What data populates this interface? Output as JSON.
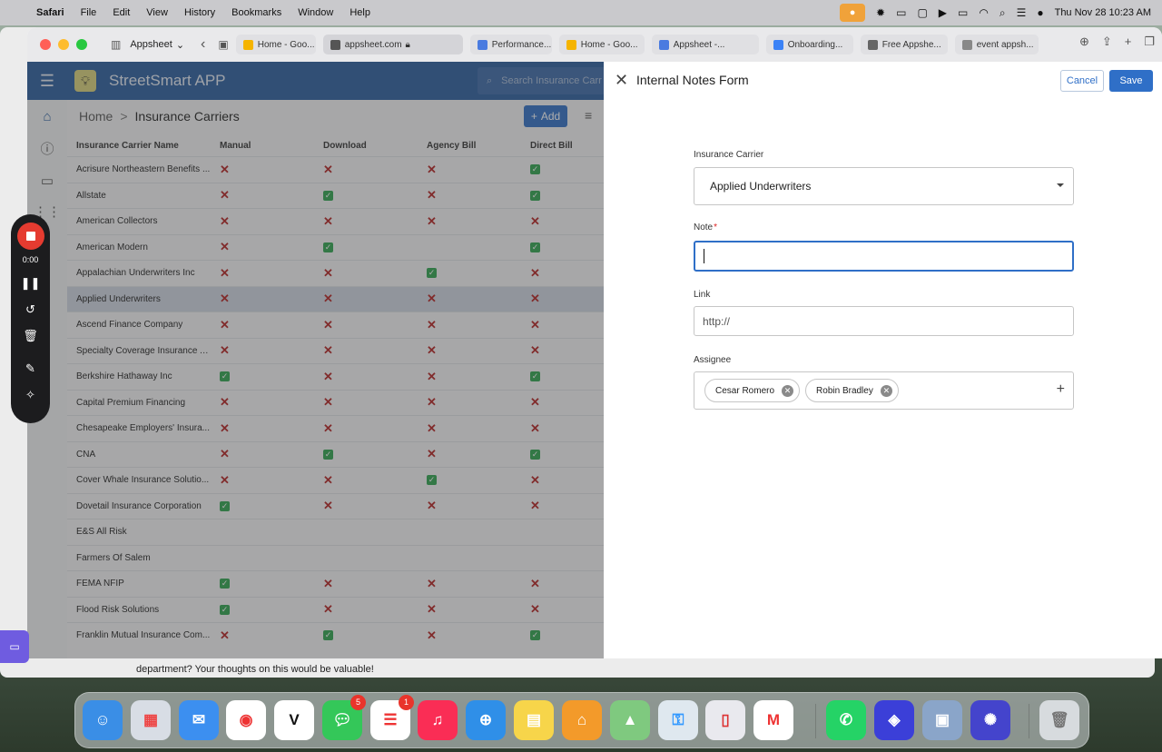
{
  "menubar": {
    "items": [
      "Safari",
      "File",
      "Edit",
      "View",
      "History",
      "Bookmarks",
      "Window",
      "Help"
    ],
    "clock": "Thu Nov 28  10:23 AM"
  },
  "browser": {
    "workspace": "Appsheet",
    "tabs": [
      {
        "label": "Home - Goo...",
        "color": "#f5b400"
      },
      {
        "label": "appsheet.com",
        "color": "#555555",
        "active": true
      },
      {
        "label": "Performance...",
        "color": "#4a7be0"
      },
      {
        "label": "Home - Goo...",
        "color": "#f5b400"
      },
      {
        "label": "Appsheet -...",
        "color": "#4a7be0"
      },
      {
        "label": "Onboarding...",
        "color": "#3b82f6"
      },
      {
        "label": "Free Appshe...",
        "color": "#666666"
      },
      {
        "label": "event appsh...",
        "color": "#888888"
      }
    ]
  },
  "app": {
    "title": "StreetSmart APP",
    "search_placeholder": "Search Insurance Carr",
    "breadcrumb_home": "Home",
    "breadcrumb_sep": ">",
    "breadcrumb_current": "Insurance Carriers",
    "add_label": "Add",
    "columns": [
      "Insurance Carrier Name",
      "Manual",
      "Download",
      "Agency Bill",
      "Direct Bill"
    ],
    "rows": [
      {
        "name": "Acrisure Northeastern Benefits ...",
        "v": [
          "x",
          "x",
          "x",
          "c"
        ]
      },
      {
        "name": "Allstate",
        "v": [
          "x",
          "c",
          "x",
          "c"
        ]
      },
      {
        "name": "American Collectors",
        "v": [
          "x",
          "x",
          "x",
          "x"
        ]
      },
      {
        "name": "American Modern",
        "v": [
          "x",
          "c",
          "",
          "c"
        ]
      },
      {
        "name": "Appalachian Underwriters Inc",
        "v": [
          "x",
          "x",
          "c",
          "x"
        ]
      },
      {
        "name": "Applied Underwriters",
        "v": [
          "x",
          "x",
          "x",
          "x"
        ],
        "selected": true
      },
      {
        "name": "Ascend Finance Company",
        "v": [
          "x",
          "x",
          "x",
          "x"
        ]
      },
      {
        "name": "Specialty Coverage Insurance A...",
        "v": [
          "x",
          "x",
          "x",
          "x"
        ]
      },
      {
        "name": "Berkshire Hathaway Inc",
        "v": [
          "c",
          "x",
          "x",
          "c"
        ]
      },
      {
        "name": "Capital Premium Financing",
        "v": [
          "x",
          "x",
          "x",
          "x"
        ]
      },
      {
        "name": "Chesapeake Employers' Insura...",
        "v": [
          "x",
          "x",
          "x",
          "x"
        ]
      },
      {
        "name": "CNA",
        "v": [
          "x",
          "c",
          "x",
          "c"
        ]
      },
      {
        "name": "Cover Whale Insurance Solutio...",
        "v": [
          "x",
          "x",
          "c",
          "x"
        ]
      },
      {
        "name": "Dovetail Insurance Corporation",
        "v": [
          "c",
          "x",
          "x",
          "x"
        ]
      },
      {
        "name": "E&S All Risk",
        "v": [
          "",
          "",
          "",
          ""
        ]
      },
      {
        "name": "Farmers Of Salem",
        "v": [
          "",
          "",
          "",
          ""
        ]
      },
      {
        "name": "FEMA NFIP",
        "v": [
          "c",
          "x",
          "x",
          "x"
        ]
      },
      {
        "name": "Flood Risk Solutions",
        "v": [
          "c",
          "x",
          "x",
          "x"
        ]
      },
      {
        "name": "Franklin Mutual Insurance Com...",
        "v": [
          "x",
          "c",
          "x",
          "c"
        ]
      }
    ]
  },
  "form": {
    "title": "Internal Notes Form",
    "cancel_label": "Cancel",
    "save_label": "Save",
    "carrier_label": "Insurance Carrier",
    "carrier_value": "Applied Underwriters",
    "note_label": "Note",
    "note_required": "*",
    "note_value": "",
    "link_label": "Link",
    "link_value": "http://",
    "assignee_label": "Assignee",
    "assignees": [
      "Cesar Romero",
      "Robin Bradley"
    ]
  },
  "recorder": {
    "time": "0:00"
  },
  "background_text": "department? Your thoughts on this would be valuable!",
  "dock": {
    "messages_badge": "5",
    "reminders_badge": "1"
  },
  "colors": {
    "app_header": "#2a5d9f",
    "accent": "#2f6fc7",
    "check": "#2ea44f",
    "cross": "#b32222"
  }
}
